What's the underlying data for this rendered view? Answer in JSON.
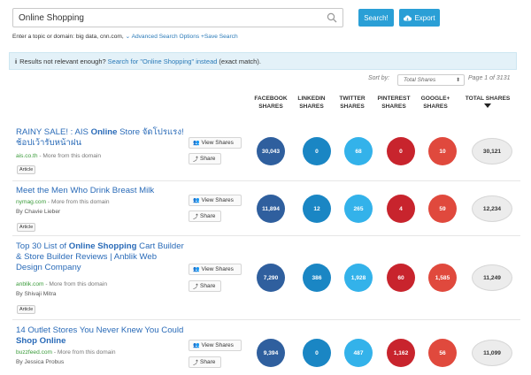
{
  "search": {
    "value": "Online Shopping",
    "search_label": "Search!",
    "export_label": "Export"
  },
  "hint": {
    "text": "Enter a topic or domain: big data, cnn.com,",
    "advanced": "Advanced Search Options",
    "save": "Save Search"
  },
  "notice": {
    "prefix": "Results not relevant enough?",
    "link": "Search for \"Online Shopping\" instead",
    "suffix": "(exact match)."
  },
  "sort": {
    "label": "Sort by:",
    "selected": "Total Shares",
    "page_info": "Page 1 of 3131"
  },
  "columns": {
    "facebook": "FACEBOOK SHARES",
    "linkedin": "LINKEDIN SHARES",
    "twitter": "TWITTER SHARES",
    "pinterest": "PINTEREST SHARES",
    "googleplus": "GOOGLE+ SHARES",
    "total": "TOTAL SHARES"
  },
  "buttons": {
    "view_shares": "View Shares",
    "share": "Share"
  },
  "results": [
    {
      "title_pre": "RAINY SALE! : AIS ",
      "title_bold": "Online",
      "title_post": " Store จัดโปรแรง! ช้อปเว้ารับหน้าฝน",
      "domain": "ais.co.th",
      "more": " - More from this domain",
      "author": "",
      "tag": "Article",
      "facebook": "30,043",
      "linkedin": "0",
      "twitter": "68",
      "pinterest": "0",
      "googleplus": "10",
      "total": "30,121"
    },
    {
      "title_pre": "Meet the Men Who Drink Breast Milk",
      "title_bold": "",
      "title_post": "",
      "domain": "nymag.com",
      "more": " - More from this domain",
      "author": "By Chavie Lieber",
      "tag": "Article",
      "facebook": "11,894",
      "linkedin": "12",
      "twitter": "265",
      "pinterest": "4",
      "googleplus": "59",
      "total": "12,234"
    },
    {
      "title_pre": "Top 30 List of ",
      "title_bold": "Online Shopping",
      "title_post": " Cart Builder & Store Builder Reviews | Anblik Web Design Company",
      "domain": "anblik.com",
      "more": " - More from this domain",
      "author": "By Shivaji Mitra",
      "tag": "Article",
      "facebook": "7,290",
      "linkedin": "386",
      "twitter": "1,928",
      "pinterest": "60",
      "googleplus": "1,585",
      "total": "11,249"
    },
    {
      "title_pre": "14 Outlet Stores You Never Knew You Could ",
      "title_bold": "Shop Online",
      "title_post": "",
      "domain": "buzzfeed.com",
      "more": " - More from this domain",
      "author": "By Jessica Probus",
      "tag": "",
      "facebook": "9,394",
      "linkedin": "0",
      "twitter": "487",
      "pinterest": "1,162",
      "googleplus": "56",
      "total": "11,099"
    }
  ],
  "colors": {
    "accent": "#2a9fd6",
    "facebook": "#2f5f9e",
    "linkedin": "#1a86c4",
    "twitter": "#33b2ea",
    "pinterest": "#c8242d",
    "googleplus": "#e0493d"
  }
}
